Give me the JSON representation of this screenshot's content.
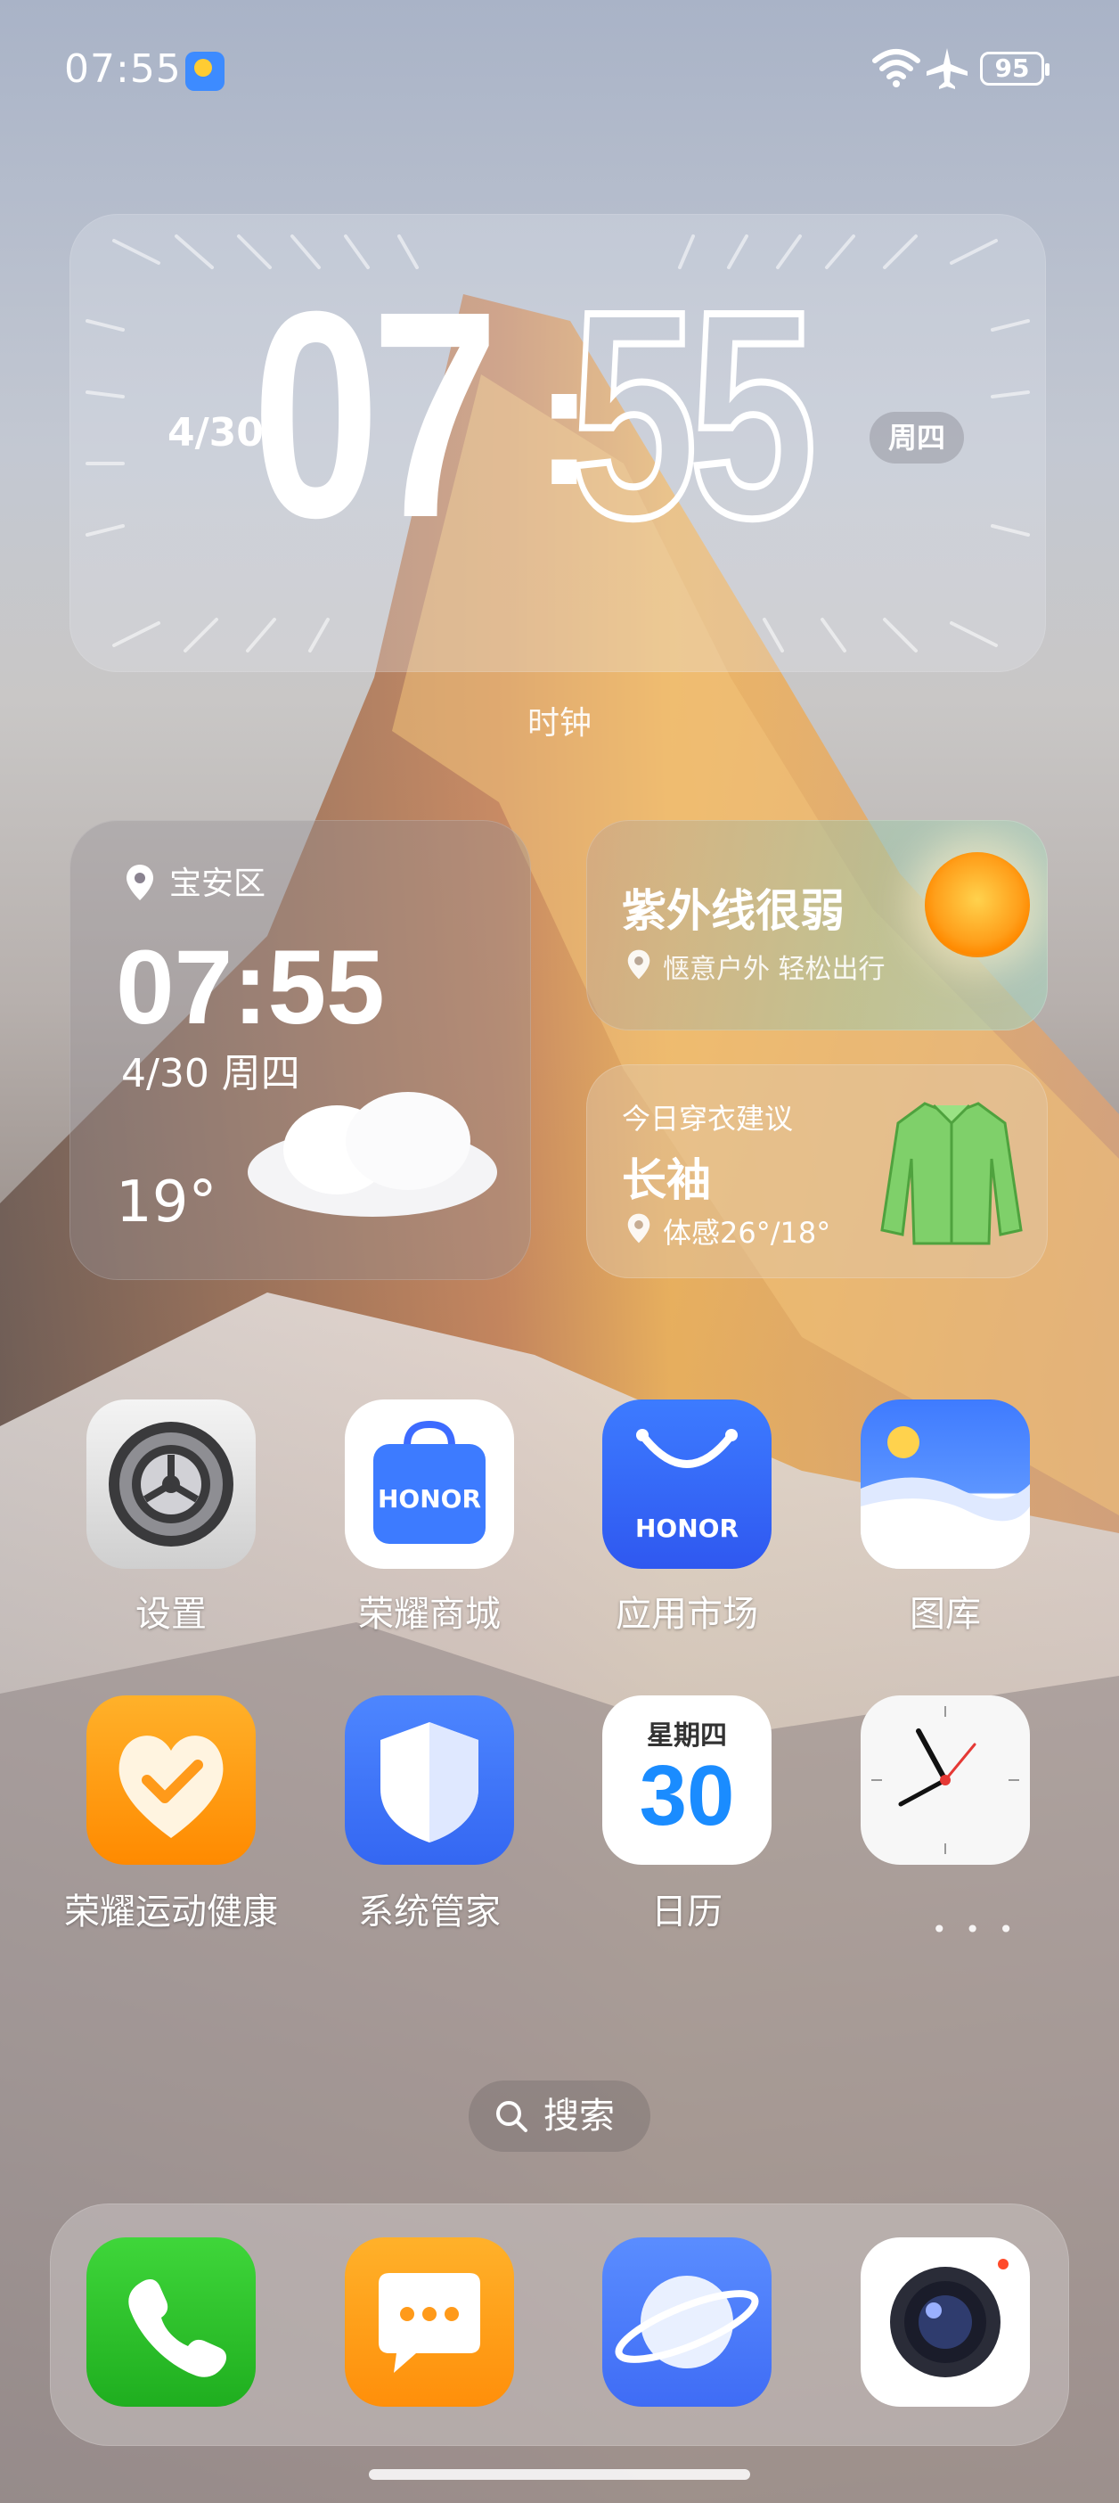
{
  "status_bar": {
    "time": "07:55",
    "battery": "95"
  },
  "clock_widget": {
    "date": "4/30",
    "hour": "07",
    "colon": ":",
    "minute": "55",
    "weekday": "周四",
    "label": "时钟"
  },
  "weather_widget": {
    "location": "宝安区",
    "time": "07:55",
    "date": "4/30 周四",
    "temperature": "19°"
  },
  "uv_widget": {
    "title": "紫外线很弱",
    "subtitle": "惬意户外 轻松出行"
  },
  "clothing_widget": {
    "title": "今日穿衣建议",
    "item": "长袖",
    "feels_like": "体感26°/18°"
  },
  "apps": {
    "settings": "设置",
    "honor_mall": "荣耀商城",
    "app_market": "应用市场",
    "gallery": "图库",
    "health": "荣耀运动健康",
    "phone_manager": "系统管家",
    "calendar": "日历",
    "calendar_weekday": "星期四",
    "calendar_day": "30",
    "honor_logo": "HONOR"
  },
  "search": {
    "label": "搜索"
  },
  "colors": {
    "phone_green": "#2ec22a",
    "message_orange": "#ff9a1a",
    "honor_blue": "#3d6bff"
  }
}
